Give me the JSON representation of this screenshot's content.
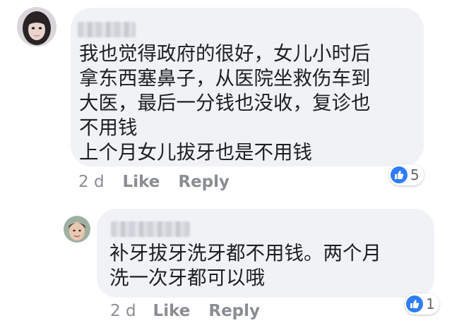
{
  "comment1": {
    "text": "我也觉得政府的很好，女儿小时后\n拿东西塞鼻子，从医院坐救伤车到\n大医，最后一分钱也没收，复诊也\n不用钱\n上个月女儿拔牙也是不用钱",
    "time": "2 d",
    "like_label": "Like",
    "reply_label": "Reply",
    "reaction_count": "5"
  },
  "reply1": {
    "text": "补牙拔牙洗牙都不用钱。两个月\n洗一次牙都可以哦",
    "time": "2 d",
    "like_label": "Like",
    "reply_label": "Reply",
    "reaction_count": "1"
  },
  "colors": {
    "bubble": "#f1f2f6",
    "like_blue": "#2e7cf6",
    "meta_gray": "#8a8d91"
  }
}
